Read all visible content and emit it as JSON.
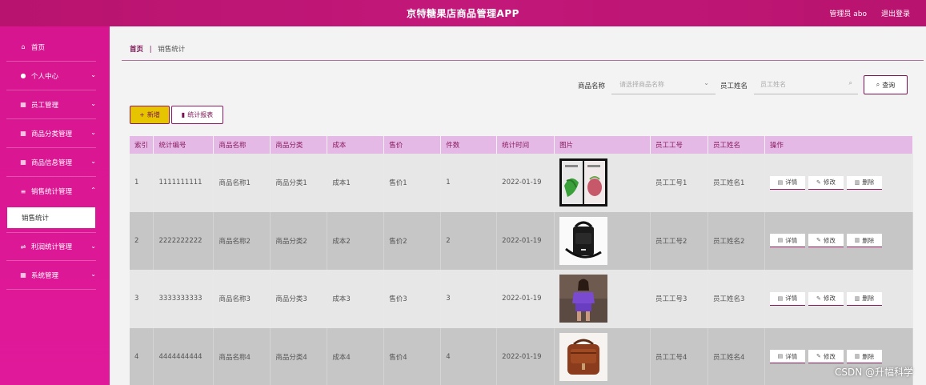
{
  "header": {
    "title": "京特糖果店商品管理APP",
    "user": "管理员 abo",
    "logout": "退出登录"
  },
  "sidebar": {
    "items": [
      {
        "label": "首页",
        "icon": "home-icon",
        "expandable": false
      },
      {
        "label": "个人中心",
        "icon": "person-icon",
        "expandable": true
      },
      {
        "label": "员工管理",
        "icon": "grid-icon",
        "expandable": true
      },
      {
        "label": "商品分类管理",
        "icon": "grid-icon",
        "expandable": true
      },
      {
        "label": "商品信息管理",
        "icon": "grid-icon",
        "expandable": true
      },
      {
        "label": "销售统计管理",
        "icon": "list-icon",
        "expandable": true
      },
      {
        "label": "利润统计管理",
        "icon": "sliders-icon",
        "expandable": true
      },
      {
        "label": "系统管理",
        "icon": "grid-icon",
        "expandable": true
      }
    ],
    "submenu": {
      "label": "销售统计"
    }
  },
  "breadcrumb": {
    "home": "首页",
    "separator": "|",
    "current": "销售统计"
  },
  "search": {
    "product_label": "商品名称",
    "product_placeholder": "请选择商品名称",
    "employee_label": "员工姓名",
    "employee_placeholder": "员工姓名",
    "query_button": "查询"
  },
  "toolbar": {
    "new_button": "新增",
    "report_button": "统计报表"
  },
  "table": {
    "headers": [
      "索引",
      "统计编号",
      "商品名称",
      "商品分类",
      "成本",
      "售价",
      "件数",
      "统计时间",
      "图片",
      "员工工号",
      "员工姓名",
      "操作"
    ],
    "rows": [
      {
        "index": "1",
        "code": "1111111111",
        "name": "商品名称1",
        "category": "商品分类1",
        "cost": "成本1",
        "price": "售价1",
        "count": "1",
        "time": "2022-01-19",
        "image": "snack-packages-image",
        "emp_no": "员工工号1",
        "emp_name": "员工姓名1"
      },
      {
        "index": "2",
        "code": "2222222222",
        "name": "商品名称2",
        "category": "商品分类2",
        "cost": "成本2",
        "price": "售价2",
        "count": "2",
        "time": "2022-01-19",
        "image": "black-bag-image",
        "emp_no": "员工工号2",
        "emp_name": "员工姓名2"
      },
      {
        "index": "3",
        "code": "3333333333",
        "name": "商品名称3",
        "category": "商品分类3",
        "cost": "成本3",
        "price": "售价3",
        "count": "3",
        "time": "2022-01-19",
        "image": "purple-outfit-image",
        "emp_no": "员工工号3",
        "emp_name": "员工姓名3"
      },
      {
        "index": "4",
        "code": "4444444444",
        "name": "商品名称4",
        "category": "商品分类4",
        "cost": "成本4",
        "price": "售价4",
        "count": "4",
        "time": "2022-01-19",
        "image": "brown-bag-image",
        "emp_no": "员工工号4",
        "emp_name": "员工姓名4"
      }
    ],
    "actions": {
      "detail": "详情",
      "edit": "修改",
      "delete": "删除"
    }
  },
  "watermark": "CSDN @升幅科学",
  "colors": {
    "header": "#b8136e",
    "sidebar": "#d7158f",
    "table_header": "#e5b9e5",
    "accent": "#8a1b60",
    "new_button": "#e6c400"
  }
}
